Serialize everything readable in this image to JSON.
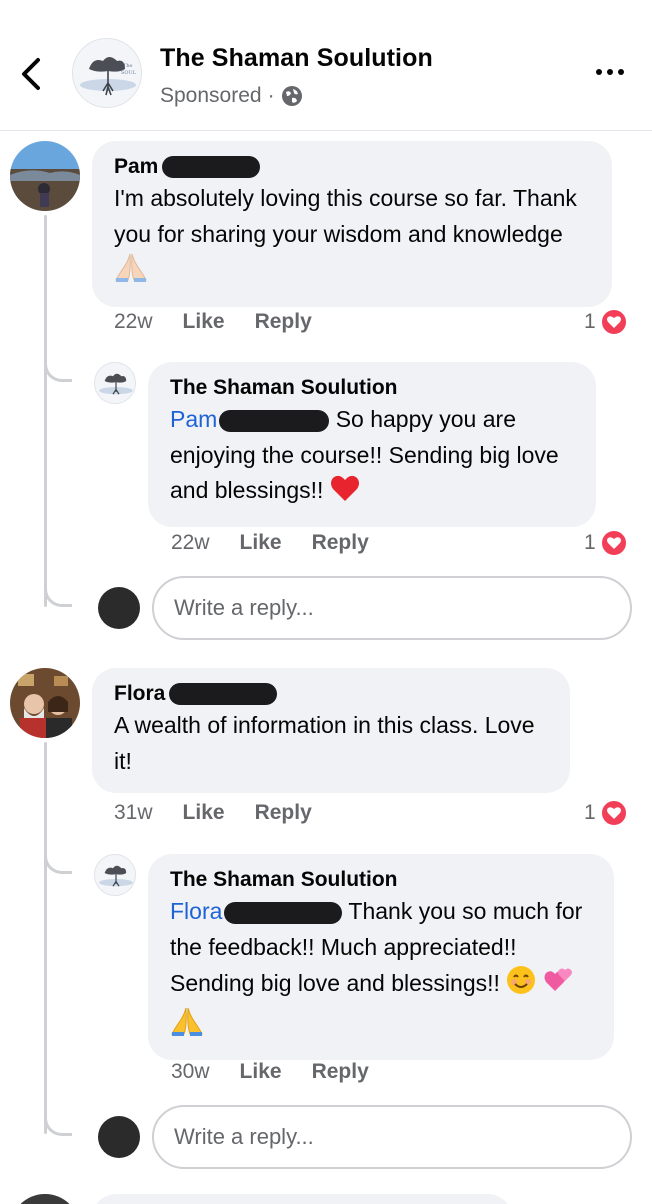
{
  "header": {
    "title": "The Shaman Soulution",
    "sponsored": "Sponsored",
    "separator": "·"
  },
  "comments": [
    {
      "author_first": "Pam",
      "text": "I'm absolutely loving this course so far. Thank you for sharing your wisdom and knowledge",
      "time": "22w",
      "like": "Like",
      "reply": "Reply",
      "reaction_count": "1",
      "replies": [
        {
          "author": "The Shaman Soulution",
          "mention": "Pam",
          "text": "So happy you are enjoying the course!! Sending big love and blessings!!",
          "time": "22w",
          "like": "Like",
          "reply": "Reply",
          "reaction_count": "1"
        }
      ],
      "reply_placeholder": "Write a reply..."
    },
    {
      "author_first": "Flora",
      "text": "A wealth of information in this class. Love it!",
      "time": "31w",
      "like": "Like",
      "reply": "Reply",
      "reaction_count": "1",
      "replies": [
        {
          "author": "The Shaman Soulution",
          "mention": "Flora",
          "text": "Thank you so much for the feedback!! Much appreciated!! Sending big love and blessings!!",
          "time": "30w",
          "like": "Like",
          "reply": "Reply"
        }
      ],
      "reply_placeholder": "Write a reply..."
    }
  ],
  "colors": {
    "bubble": "#f0f2f5",
    "muted": "#65676b",
    "mention": "#1e63d6",
    "love": "#f33e58"
  },
  "icons": [
    "back-arrow-icon",
    "globe-icon",
    "more-options-icon",
    "love-reaction-icon"
  ]
}
